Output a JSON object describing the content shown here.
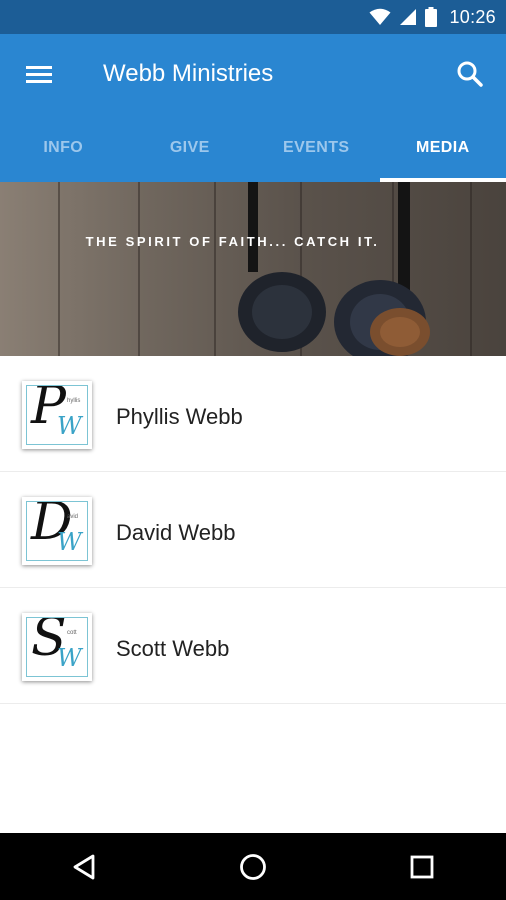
{
  "status_bar": {
    "time": "10:26",
    "icons": [
      "wifi-icon",
      "cell-signal-icon",
      "battery-icon"
    ],
    "color": "#1c5d96"
  },
  "app_bar": {
    "title": "Webb Ministries",
    "color": "#2a86d1",
    "left_icon": "menu-icon",
    "right_icon": "search-icon"
  },
  "tabs": [
    {
      "label": "INFO",
      "active": false
    },
    {
      "label": "GIVE",
      "active": false
    },
    {
      "label": "EVENTS",
      "active": false
    },
    {
      "label": "MEDIA",
      "active": true
    }
  ],
  "banner": {
    "tagline": "THE SPIRIT OF FAITH... CATCH IT.",
    "image": "headphones-on-wood"
  },
  "media_list": [
    {
      "name": "Phyllis Webb",
      "thumb_letter": "P",
      "thumb_sub": "hyllis"
    },
    {
      "name": "David Webb",
      "thumb_letter": "D",
      "thumb_sub": "avid"
    },
    {
      "name": "Scott Webb",
      "thumb_letter": "S",
      "thumb_sub": "cott"
    }
  ],
  "nav_bar": {
    "buttons": [
      "back-icon",
      "home-icon",
      "recents-icon"
    ]
  }
}
